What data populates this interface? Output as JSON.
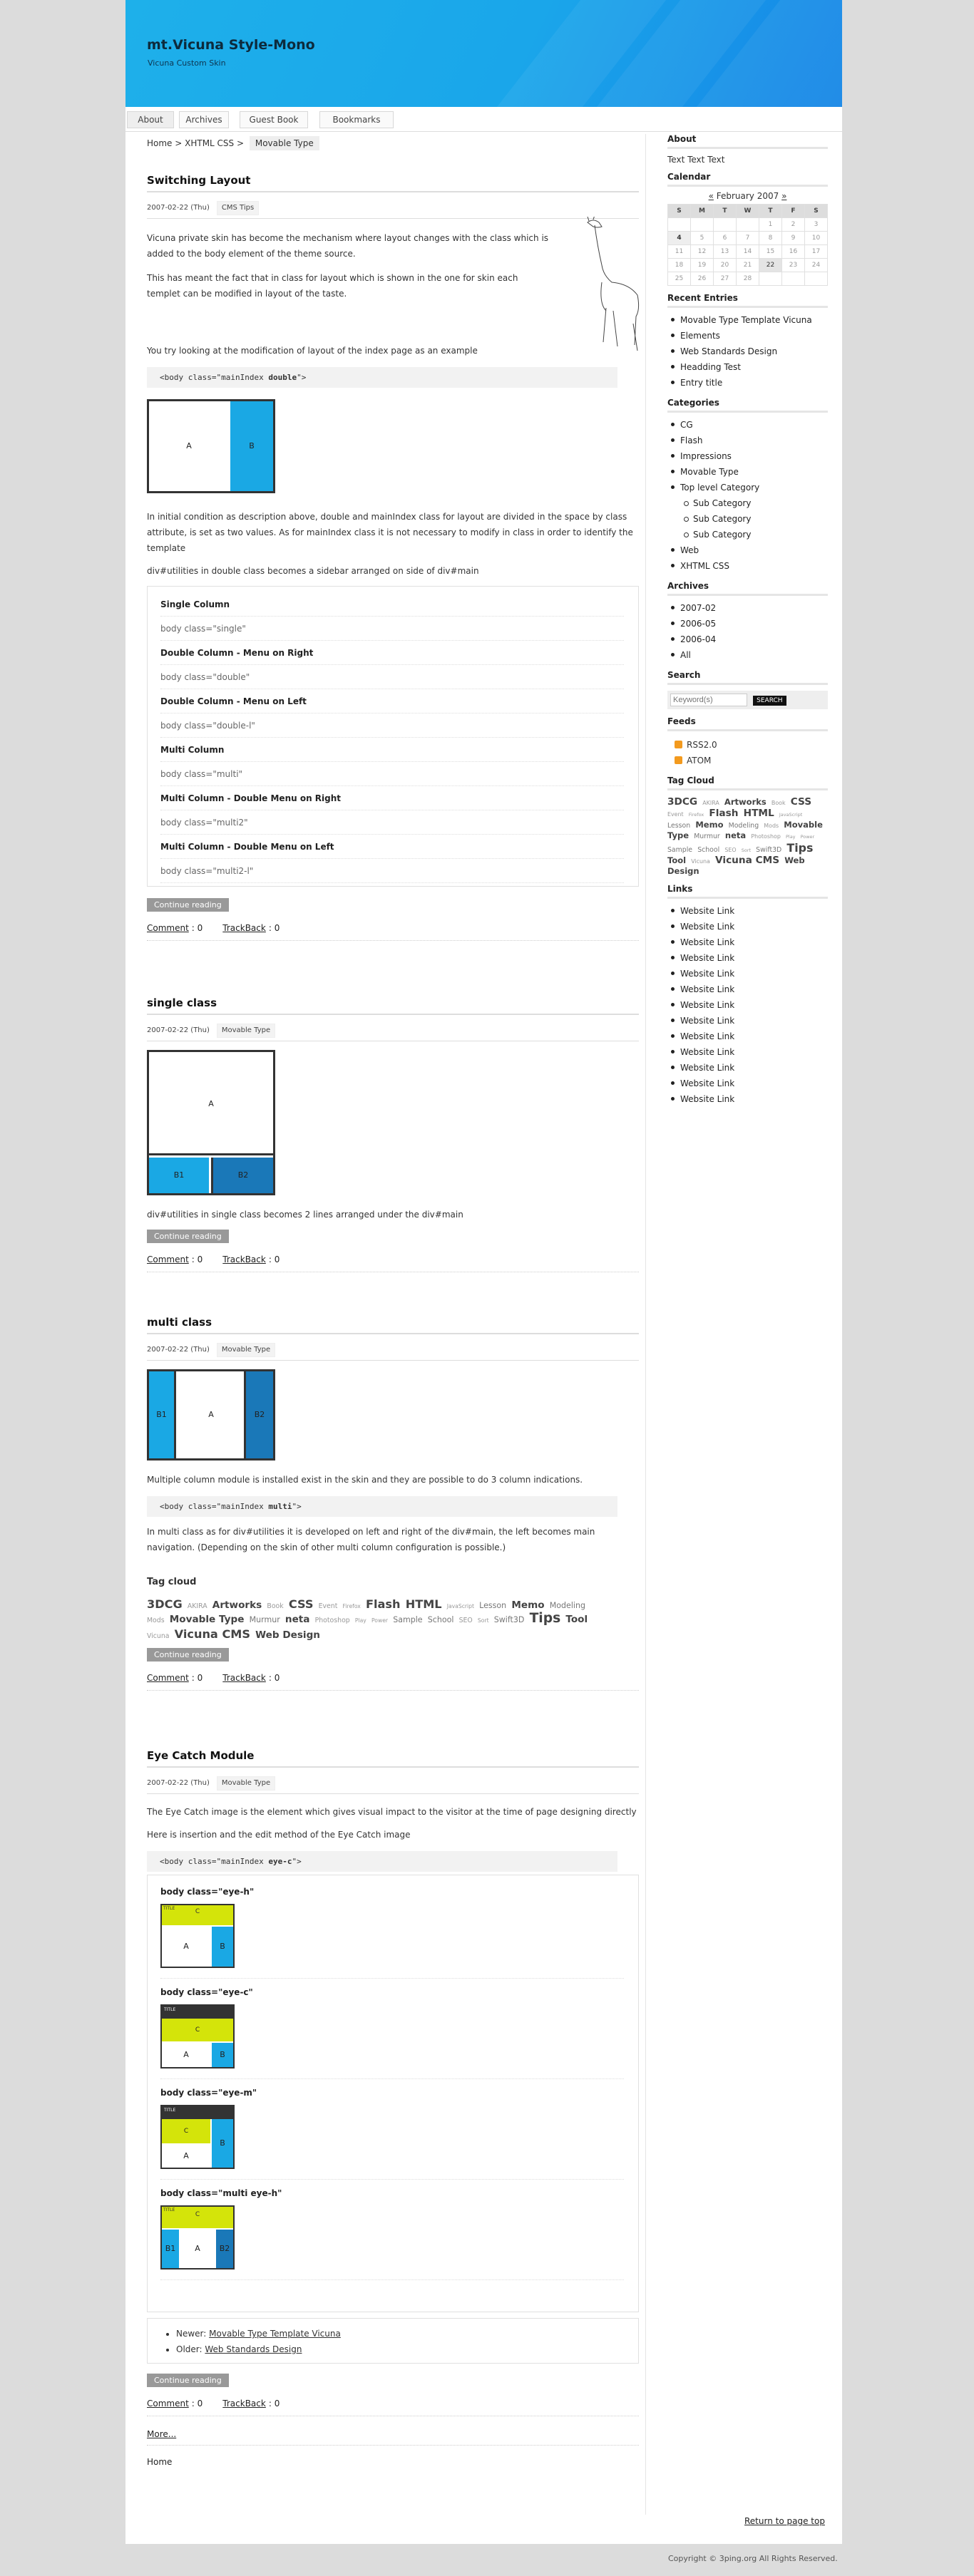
{
  "site": {
    "title": "mt.Vicuna Style-Mono",
    "desc": "Vicuna Custom Skin"
  },
  "nav": [
    "About",
    "Archives",
    "Guest Book",
    "Bookmarks"
  ],
  "topicPath": {
    "home": "Home",
    "sep": " > ",
    "cat": "XHTML CSS",
    "cur": "Movable Type"
  },
  "e1": {
    "title": "Switching Layout",
    "date": "2007-02-22 (Thu)",
    "cat": "CMS Tips",
    "p1": "Vicuna private skin has become the mechanism where layout changes with the class which is added to the body element of the theme source.",
    "p2": "This has meant the fact that in class for layout which is shown in the one for skin each templet can be modified in layout of the taste.",
    "p3": "You try looking at the modification of layout of the index page as an example",
    "code_pre": "<body class=\"mainIndex ",
    "code_b": "double",
    "code_post": "\">",
    "diagA": "A",
    "diagB": "B",
    "p4": "In initial condition as description above, double and mainIndex class for layout are divided in the space by class attribute, is set as two values. As for mainIndex class it is not necessary to modify in class in order to identify the template",
    "p5": "div#utilities in double class becomes a sidebar arranged on side of div#main",
    "rows": [
      {
        "h": "Single Column",
        "v": "body class=\"single\""
      },
      {
        "h": "Double Column - Menu on Right",
        "v": "body class=\"double\""
      },
      {
        "h": "Double Column - Menu on Left",
        "v": "body class=\"double-l\""
      },
      {
        "h": "Multi Column",
        "v": "body class=\"multi\""
      },
      {
        "h": "Multi Column - Double Menu on Right",
        "v": "body class=\"multi2\""
      },
      {
        "h": "Multi Column - Double Menu on Left",
        "v": "body class=\"multi2-l\""
      }
    ],
    "more": "Continue reading",
    "comment": "Comment",
    "cn": "0",
    "trackback": "TrackBack",
    "tn": "0"
  },
  "e2": {
    "title": "single class",
    "date": "2007-02-22 (Thu)",
    "cat": "Movable Type",
    "diagA": "A",
    "diagB1": "B1",
    "diagB2": "B2",
    "p1": "div#utilities in single class becomes 2 lines arranged under the div#main",
    "more": "Continue reading",
    "comment": "Comment",
    "cn": "0",
    "trackback": "TrackBack",
    "tn": "0"
  },
  "e3": {
    "title": "multi class",
    "date": "2007-02-22 (Thu)",
    "cat": "Movable Type",
    "diagA": "A",
    "diagB1": "B1",
    "diagB2": "B2",
    "p1": "Multiple column module is installed exist in the skin and they are possible to do 3 column indications.",
    "code_pre": "<body class=\"mainIndex ",
    "code_b": "multi",
    "code_post": "\">",
    "p2": "In multi class as for div#utilities it is developed on left and right of the div#main, the left becomes main navigation. (Depending on the skin of other multi column configuration is possible.)",
    "cloudTitle": "Tag cloud",
    "more": "Continue reading",
    "comment": "Comment",
    "cn": "0",
    "trackback": "TrackBack",
    "tn": "0"
  },
  "tags": [
    {
      "t": "3DCG",
      "s": 3
    },
    {
      "t": "AKIRA",
      "s": 0
    },
    {
      "t": "Artworks",
      "s": 2
    },
    {
      "t": "Book",
      "s": 0
    },
    {
      "t": "CSS",
      "s": 3
    },
    {
      "t": "Event",
      "s": 0
    },
    {
      "t": "Firefox",
      "s": -1
    },
    {
      "t": "Flash",
      "s": 3
    },
    {
      "t": "HTML",
      "s": 3
    },
    {
      "t": "JavaScript",
      "s": -1
    },
    {
      "t": "Lesson",
      "s": 1
    },
    {
      "t": "Memo",
      "s": 2
    },
    {
      "t": "Modeling",
      "s": 1
    },
    {
      "t": "Mods",
      "s": 0
    },
    {
      "t": "Movable Type",
      "s": 2
    },
    {
      "t": "Murmur",
      "s": 1
    },
    {
      "t": "neta",
      "s": 2
    },
    {
      "t": "Photoshop",
      "s": 0
    },
    {
      "t": "Play",
      "s": -1
    },
    {
      "t": "Power",
      "s": -1
    },
    {
      "t": "Sample",
      "s": 1
    },
    {
      "t": "School",
      "s": 1
    },
    {
      "t": "SEO",
      "s": 0
    },
    {
      "t": "Sort",
      "s": -1
    },
    {
      "t": "Swift3D",
      "s": 1
    },
    {
      "t": "Tips",
      "s": 4
    },
    {
      "t": "Tool",
      "s": 2
    },
    {
      "t": "Vicuna",
      "s": 0
    },
    {
      "t": "Vicuna CMS",
      "s": 3
    },
    {
      "t": "Web Design",
      "s": 2
    }
  ],
  "e4": {
    "title": "Eye Catch Module",
    "date": "2007-02-22 (Thu)",
    "cat": "Movable Type",
    "p1": "The Eye Catch image is the element which gives visual impact to the visitor at the time of page designing directly",
    "p2": "Here is insertion and the edit method of the Eye Catch image",
    "code_pre": "<body class=\"mainIndex ",
    "code_b": "eye-c",
    "code_post": "\">",
    "sub": [
      {
        "h": "body class=\"eye-h\""
      },
      {
        "h": "body class=\"eye-c\""
      },
      {
        "h": "body class=\"eye-m\""
      },
      {
        "h": "body class=\"multi eye-h\""
      }
    ],
    "dTitle": "TITLE",
    "dC": "C",
    "dA": "A",
    "dB": "B",
    "dB1": "B1",
    "dB2": "B2",
    "newerLabel": "Newer:",
    "newer": "Movable Type Template Vicuna",
    "olderLabel": "Older:",
    "older": "Web Standards Design",
    "more": "Continue reading",
    "comment": "Comment",
    "cn": "0",
    "trackback": "TrackBack",
    "tn": "0"
  },
  "moreLink": "More...",
  "homeLink": "Home",
  "returnTop": "Return to page top",
  "copyright": "Copyright © 3ping.org All Rights Reserved.",
  "side": {
    "about": "About",
    "aboutText": "Text Text Text",
    "calendar": "Calendar",
    "month": "February 2007",
    "prev": "«",
    "next": "»",
    "days": [
      "S",
      "M",
      "T",
      "W",
      "T",
      "F",
      "S"
    ],
    "weeks": [
      [
        "",
        "",
        "",
        "",
        "1",
        "2",
        "3"
      ],
      [
        "4",
        "5",
        "6",
        "7",
        "8",
        "9",
        "10"
      ],
      [
        "11",
        "12",
        "13",
        "14",
        "15",
        "16",
        "17"
      ],
      [
        "18",
        "19",
        "20",
        "21",
        "22",
        "23",
        "24"
      ],
      [
        "25",
        "26",
        "27",
        "28",
        "",
        "",
        ""
      ]
    ],
    "recent": "Recent Entries",
    "recentItems": [
      "Movable Type Template Vicuna",
      "Elements",
      "Web Standards Design",
      "Headding Test",
      "Entry title"
    ],
    "categories": "Categories",
    "catItems": [
      "CG",
      "Flash",
      "Impressions",
      "Movable Type",
      "Top level Category"
    ],
    "subItems": [
      "Sub Category",
      "Sub Category",
      "Sub Category"
    ],
    "catItems2": [
      "Web",
      "XHTML CSS"
    ],
    "archives": "Archives",
    "archItems": [
      "2007-02",
      "2006-05",
      "2006-04",
      "All"
    ],
    "search": "Search",
    "searchPlaceholder": "Keyword(s)",
    "searchBtn": "SEARCH",
    "feeds": "Feeds",
    "feedItems": [
      "RSS2.0",
      "ATOM"
    ],
    "tagCloud": "Tag Cloud",
    "links": "Links",
    "linkItems": [
      "Website Link",
      "Website Link",
      "Website Link",
      "Website Link",
      "Website Link",
      "Website Link",
      "Website Link",
      "Website Link",
      "Website Link",
      "Website Link",
      "Website Link",
      "Website Link",
      "Website Link"
    ]
  },
  "colors": {
    "header": "#1aa6ea",
    "blue": "#1aa8e4",
    "darkblue": "#1a78b8",
    "lime": "#d4e40a"
  }
}
